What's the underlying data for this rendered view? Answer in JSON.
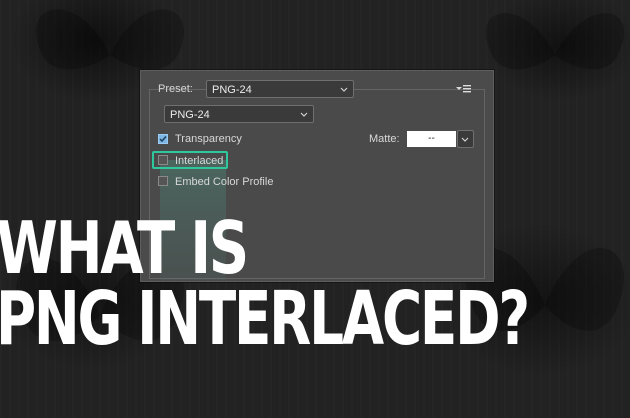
{
  "dialog": {
    "preset_label": "Preset:",
    "preset_value": "PNG-24",
    "format_value": "PNG-24",
    "menu_icon": "panel-menu-icon",
    "options": [
      {
        "label": "Transparency",
        "checked": true
      },
      {
        "label": "Interlaced",
        "checked": false
      },
      {
        "label": "Embed Color Profile",
        "checked": false
      }
    ],
    "matte_label": "Matte:",
    "matte_value": "--"
  },
  "headline": {
    "line1": "WHAT IS",
    "line2": "PNG INTERLACED?"
  },
  "colors": {
    "highlight": "#2fc79c",
    "background": "#222222",
    "dialog": "#4b4b4b"
  }
}
